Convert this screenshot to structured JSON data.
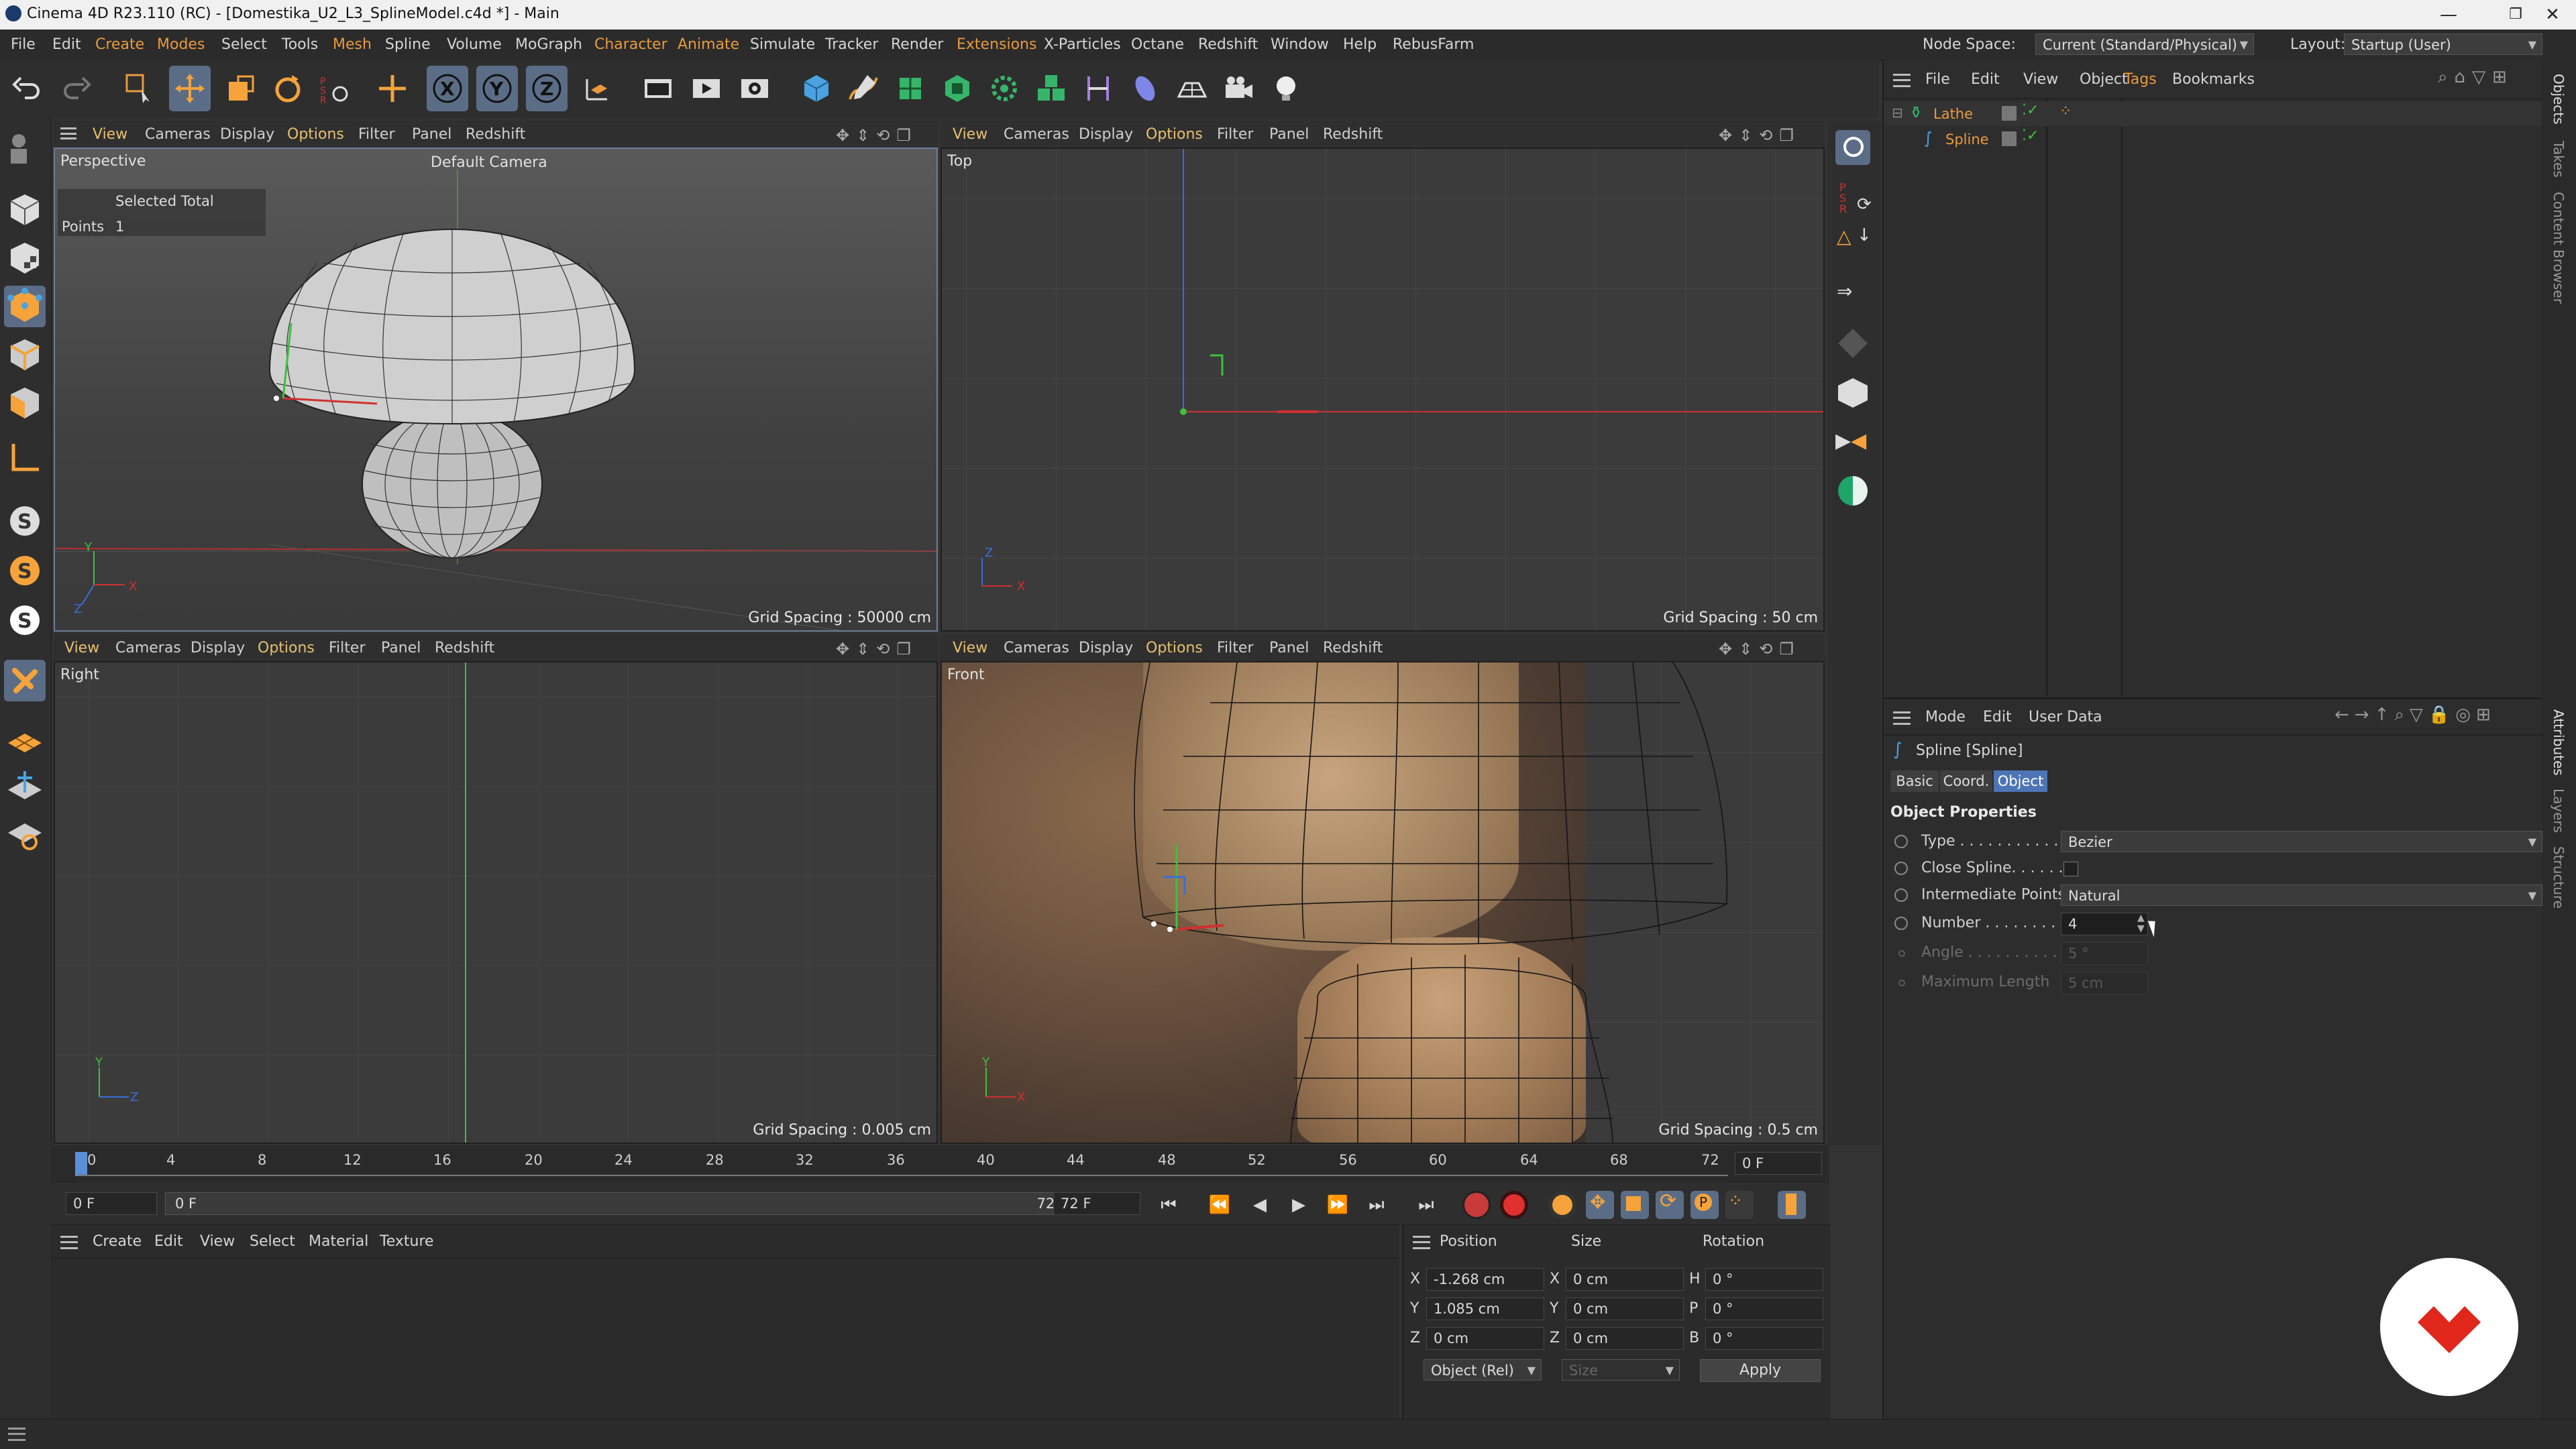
{
  "window": {
    "title": "Cinema 4D R23.110 (RC) - [Domestika_U2_L3_SplineModel.c4d *] - Main",
    "controls": [
      "—",
      "❐",
      "✕"
    ]
  },
  "menubar": {
    "items": [
      "File",
      "Edit",
      "Create",
      "Modes",
      "Select",
      "Tools",
      "Mesh",
      "Spline",
      "Volume",
      "MoGraph",
      "Character",
      "Animate",
      "Simulate",
      "Tracker",
      "Render",
      "Extensions",
      "X-Particles",
      "Octane",
      "Redshift",
      "Window",
      "Help",
      "RebusFarm"
    ],
    "node_space_label": "Node Space:",
    "node_space_value": "Current (Standard/Physical)",
    "layout_label": "Layout:",
    "layout_value": "Startup (User)"
  },
  "viewports": {
    "menu": [
      "View",
      "Cameras",
      "Display",
      "Options",
      "Filter",
      "Panel",
      "Redshift"
    ],
    "perspective": {
      "name": "Perspective",
      "camera": "Default Camera",
      "hud_header": "Selected Total",
      "hud_label": "Points",
      "hud_value": "1",
      "grid_spacing": "Grid Spacing : 50000 cm"
    },
    "top": {
      "name": "Top",
      "grid_spacing": "Grid Spacing : 50 cm"
    },
    "right": {
      "name": "Right",
      "grid_spacing": "Grid Spacing : 0.005 cm"
    },
    "front": {
      "name": "Front",
      "grid_spacing": "Grid Spacing : 0.5 cm"
    },
    "axis": {
      "x": "X",
      "y": "Y",
      "z": "Z"
    }
  },
  "timeline": {
    "ticks": [
      "0",
      "4",
      "8",
      "12",
      "16",
      "20",
      "24",
      "28",
      "32",
      "36",
      "40",
      "44",
      "48",
      "52",
      "56",
      "60",
      "64",
      "68",
      "72"
    ],
    "current_frame_right": "0 F",
    "start_frame": "0 F",
    "range_start": "0 F",
    "range_end": "72 F",
    "end_frame": "72 F"
  },
  "material_manager": {
    "menu": [
      "Create",
      "Edit",
      "View",
      "Select",
      "Material",
      "Texture"
    ]
  },
  "coordinates": {
    "headers": {
      "position": "Position",
      "size": "Size",
      "rotation": "Rotation"
    },
    "rows": [
      {
        "axis": "X",
        "pos": "-1.268 cm",
        "size_axis": "X",
        "size": "0 cm",
        "rot_axis": "H",
        "rot": "0 °"
      },
      {
        "axis": "Y",
        "pos": "1.085 cm",
        "size_axis": "Y",
        "size": "0 cm",
        "rot_axis": "P",
        "rot": "0 °"
      },
      {
        "axis": "Z",
        "pos": "0 cm",
        "size_axis": "Z",
        "size": "0 cm",
        "rot_axis": "B",
        "rot": "0 °"
      }
    ],
    "mode": "Object (Rel)",
    "size_mode": "Size",
    "apply": "Apply"
  },
  "object_manager": {
    "menu": [
      "File",
      "Edit",
      "View",
      "Object",
      "Tags",
      "Bookmarks"
    ],
    "objects": [
      {
        "name": "Lathe"
      },
      {
        "name": "Spline"
      }
    ]
  },
  "attributes": {
    "menu": [
      "Mode",
      "Edit",
      "User Data"
    ],
    "object_title": "Spline [Spline]",
    "tabs": [
      "Basic",
      "Coord.",
      "Object"
    ],
    "section": "Object Properties",
    "type_label": "Type . . . . . . . . . . .",
    "type_value": "Bezier",
    "close_label": "Close Spline. . . . . .",
    "intermediate_label": "Intermediate Points",
    "intermediate_value": "Natural",
    "number_label": "Number . . . . . . . .",
    "number_value": "4",
    "angle_label": "Angle . . . . . . . . . .",
    "angle_value": "5 °",
    "maxlen_label": "Maximum Length",
    "maxlen_value": "5 cm"
  },
  "side_tabs": {
    "top": [
      "Objects",
      "Takes",
      "Content Browser"
    ],
    "bottom": [
      "Attributes",
      "Layers",
      "Structure"
    ]
  },
  "colors": {
    "accent_blue": "#5b6d86",
    "x_axis": "#d03030",
    "y_axis": "#3ec03e",
    "z_axis": "#3a6ed8",
    "orange": "#e89a3c",
    "logo_red": "#e1261c"
  }
}
